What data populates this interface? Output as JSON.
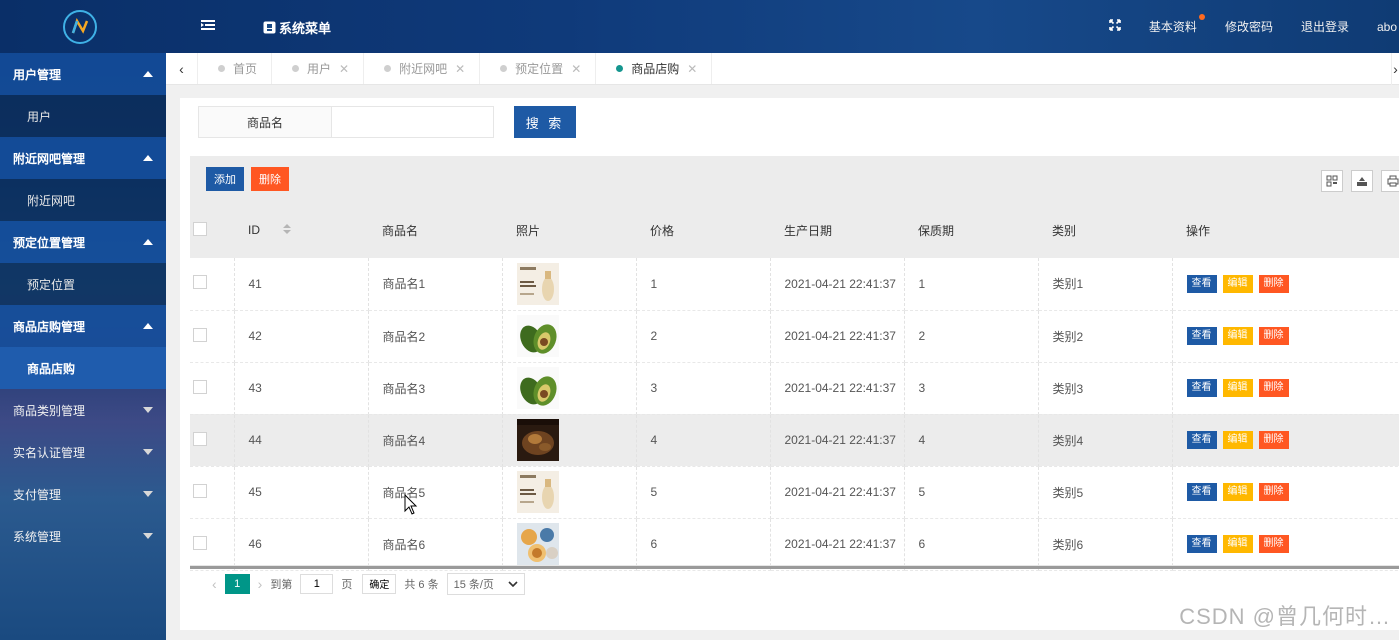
{
  "topbar": {
    "system_menu": "系统菜单",
    "basic_info": "基本资料",
    "change_password": "修改密码",
    "logout": "退出登录",
    "username": "abo"
  },
  "sidebar": {
    "groups": [
      {
        "label": "用户管理",
        "open": true,
        "children": [
          "用户"
        ]
      },
      {
        "label": "附近网吧管理",
        "open": true,
        "children": [
          "附近网吧"
        ]
      },
      {
        "label": "预定位置管理",
        "open": true,
        "children": [
          "预定位置"
        ]
      },
      {
        "label": "商品店购管理",
        "open": true,
        "children": [
          "商品店购"
        ]
      },
      {
        "label": "商品类别管理",
        "open": false,
        "children": []
      },
      {
        "label": "实名认证管理",
        "open": false,
        "children": []
      },
      {
        "label": "支付管理",
        "open": false,
        "children": []
      },
      {
        "label": "系统管理",
        "open": false,
        "children": []
      }
    ]
  },
  "tabs": [
    {
      "label": "首页",
      "closable": false,
      "active": false
    },
    {
      "label": "用户",
      "closable": true,
      "active": false
    },
    {
      "label": "附近网吧",
      "closable": true,
      "active": false
    },
    {
      "label": "预定位置",
      "closable": true,
      "active": false
    },
    {
      "label": "商品店购",
      "closable": true,
      "active": true
    }
  ],
  "search": {
    "label": "商品名",
    "value": "",
    "button": "搜 索"
  },
  "toolbar": {
    "add": "添加",
    "delete": "删除"
  },
  "table": {
    "columns": [
      "ID",
      "商品名",
      "照片",
      "价格",
      "生产日期",
      "保质期",
      "类别",
      "操作"
    ],
    "rows": [
      {
        "id": "41",
        "name": "商品名1",
        "photo": "packaged-product",
        "price": "1",
        "date": "2021-04-21 22:41:37",
        "shelf": "1",
        "category": "类别1"
      },
      {
        "id": "42",
        "name": "商品名2",
        "photo": "avocado",
        "price": "2",
        "date": "2021-04-21 22:41:37",
        "shelf": "2",
        "category": "类别2"
      },
      {
        "id": "43",
        "name": "商品名3",
        "photo": "avocado",
        "price": "3",
        "date": "2021-04-21 22:41:37",
        "shelf": "3",
        "category": "类别3"
      },
      {
        "id": "44",
        "name": "商品名4",
        "photo": "dark-food",
        "price": "4",
        "date": "2021-04-21 22:41:37",
        "shelf": "4",
        "category": "类别4"
      },
      {
        "id": "45",
        "name": "商品名5",
        "photo": "packaged-product",
        "price": "5",
        "date": "2021-04-21 22:41:37",
        "shelf": "5",
        "category": "类别5"
      },
      {
        "id": "46",
        "name": "商品名6",
        "photo": "mooncakes",
        "price": "6",
        "date": "2021-04-21 22:41:37",
        "shelf": "6",
        "category": "类别6"
      }
    ],
    "actions": {
      "view": "查看",
      "edit": "编辑",
      "delete": "删除"
    },
    "hover_row": 3
  },
  "pager": {
    "current": "1",
    "goto_prefix": "到第",
    "goto_value": "1",
    "goto_suffix": "页",
    "ok": "确定",
    "total": "共 6 条",
    "page_size": "15 条/页"
  },
  "watermark": "CSDN @曾几何时…",
  "colors": {
    "primary": "#1e5aa5",
    "danger": "#ff5722",
    "warning": "#ffb800",
    "teal": "#009688"
  }
}
